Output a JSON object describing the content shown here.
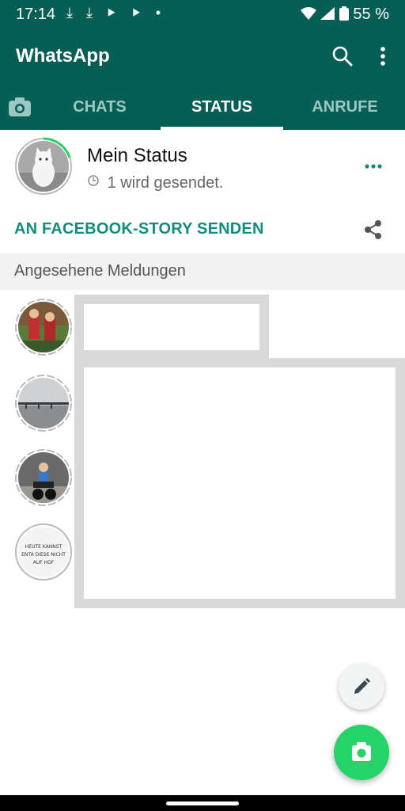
{
  "status_bar": {
    "time": "17:14",
    "icons_left": "⤓ ⤓ ⯈ ⯈ •",
    "battery_percent": "55 %"
  },
  "app_bar": {
    "title": "WhatsApp",
    "search_icon": "search-icon",
    "more_icon": "more-vert-icon"
  },
  "tabs": [
    {
      "label": "CHATS",
      "active": false
    },
    {
      "label": "STATUS",
      "active": true
    },
    {
      "label": "ANRUFE",
      "active": false
    }
  ],
  "my_status": {
    "name": "Mein Status",
    "subtitle": "1 wird gesendet."
  },
  "facebook_share": {
    "label": "AN FACEBOOK-STORY SENDEN"
  },
  "section_header": "Angesehene Meldungen",
  "viewed_status_items": [
    {
      "thumb": "kids-photo"
    },
    {
      "thumb": "pier-photo"
    },
    {
      "thumb": "motorcycle-photo"
    },
    {
      "thumb": "text-image",
      "thumb_text": "HEUTE KANNST ENTA DIESE NICHT AUF HOF"
    }
  ],
  "colors": {
    "header": "#075e54",
    "accent": "#128c7e",
    "fab": "#25d366"
  }
}
